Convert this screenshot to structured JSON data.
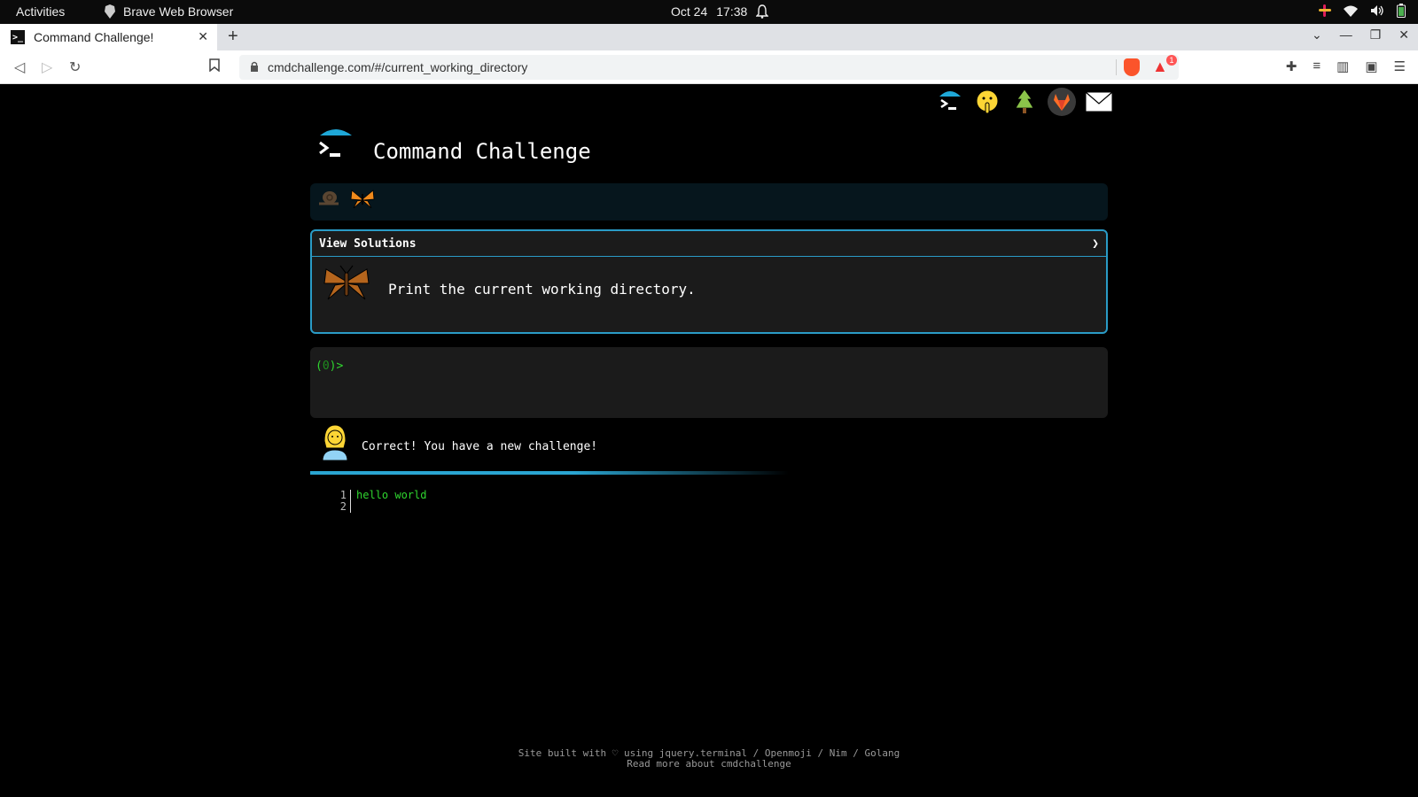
{
  "os": {
    "activities": "Activities",
    "app_name": "Brave Web Browser",
    "date": "Oct 24",
    "time": "17:38"
  },
  "browser": {
    "tab_title": "Command Challenge!",
    "url": "cmdchallenge.com/#/current_working_directory",
    "rewards_badge": "1"
  },
  "page": {
    "title": "Command Challenge",
    "solutions_label": "View Solutions",
    "solutions_chevron": "❯",
    "task": "Print the current working directory.",
    "prompt_open": "(",
    "prompt_num": "0",
    "prompt_close": ")>",
    "feedback": "Correct! You have a new challenge!",
    "output_lines": [
      {
        "num": "1",
        "text": "hello world"
      },
      {
        "num": "2",
        "text": ""
      }
    ],
    "footer_line1": "Site built with ♡ using jquery.terminal / Openmoji / Nim / Golang",
    "footer_line2": "Read more about cmdchallenge"
  },
  "colors": {
    "accent": "#2a9bc6",
    "prompt_green": "#2fd62f",
    "panel_bg": "#1b1b1b"
  },
  "icons": {
    "social": [
      "cmdchallenge-logo-icon",
      "shushing-face-icon",
      "tree-icon",
      "gitlab-icon",
      "email-icon"
    ],
    "badges": [
      "snail-icon",
      "butterfly-icon"
    ]
  }
}
